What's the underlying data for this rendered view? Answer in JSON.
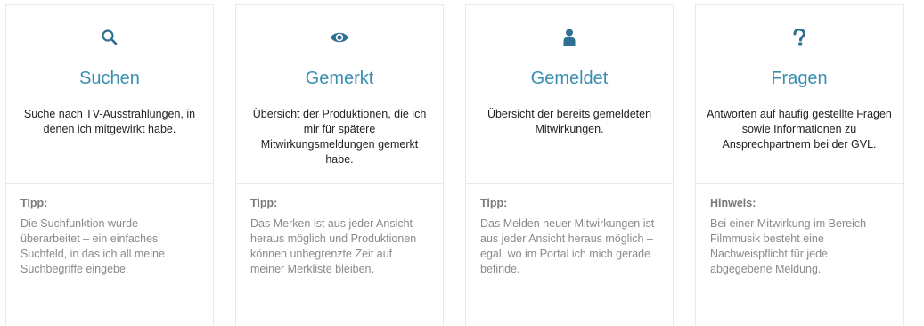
{
  "cards": [
    {
      "icon": "search-icon",
      "title": "Suchen",
      "description": "Suche nach TV-Ausstrahlungen, in denen ich mitgewirkt habe.",
      "tip_label": "Tipp:",
      "tip_text": "Die Suchfunktion wurde überarbeitet – ein einfaches Suchfeld, in das ich all meine Suchbegriffe eingebe."
    },
    {
      "icon": "eye-icon",
      "title": "Gemerkt",
      "description": "Übersicht der Produktionen, die ich mir für spätere Mitwirkungsmeldungen gemerkt habe.",
      "tip_label": "Tipp:",
      "tip_text": "Das Merken ist aus jeder Ansicht heraus möglich und Produktionen können unbegrenzte Zeit auf meiner Merkliste bleiben."
    },
    {
      "icon": "user-icon",
      "title": "Gemeldet",
      "description": "Übersicht der bereits gemeldeten Mitwirkungen.",
      "tip_label": "Tipp:",
      "tip_text": "Das Melden neuer Mitwirkungen ist aus jeder Ansicht heraus möglich – egal, wo im Portal ich mich gerade befinde."
    },
    {
      "icon": "question-icon",
      "title": "Fragen",
      "description": "Antworten auf häufig gestellte Fragen sowie Informationen zu Ansprechpartnern bei der GVL.",
      "tip_label": "Hinweis:",
      "tip_text": "Bei einer Mitwirkung im Bereich Filmmusik besteht eine Nachweispflicht für jede abgegebene Meldung."
    }
  ],
  "colors": {
    "accent": "#3a8fb1",
    "icon": "#2e6f92",
    "border": "#e9e9e9",
    "text": "#222222",
    "muted": "#8a8a8a"
  }
}
